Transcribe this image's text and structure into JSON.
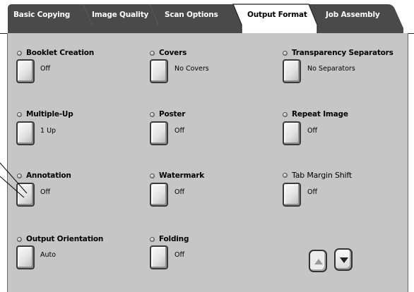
{
  "tabs": [
    {
      "label": "Basic Copying",
      "active": false
    },
    {
      "label": "Image Quality",
      "active": false
    },
    {
      "label": "Scan Options",
      "active": false
    },
    {
      "label": "Output Format",
      "active": true
    },
    {
      "label": "Job Assembly",
      "active": false
    }
  ],
  "features": {
    "booklet_creation": {
      "title": "Booklet Creation",
      "value": "Off"
    },
    "covers": {
      "title": "Covers",
      "value": "No Covers"
    },
    "transparency_separators": {
      "title": "Transparency Separators",
      "value": "No Separators"
    },
    "multiple_up": {
      "title": "Multiple-Up",
      "value": "1 Up"
    },
    "poster": {
      "title": "Poster",
      "value": "Off"
    },
    "repeat_image": {
      "title": "Repeat Image",
      "value": "Off"
    },
    "annotation": {
      "title": "Annotation",
      "value": "Off"
    },
    "watermark": {
      "title": "Watermark",
      "value": "Off"
    },
    "tab_margin_shift": {
      "title": "Tab Margin Shift",
      "value": "Off"
    },
    "output_orientation": {
      "title": "Output Orientation",
      "value": "Auto"
    },
    "folding": {
      "title": "Folding",
      "value": "Off"
    }
  },
  "scroll": {
    "up_icon": "triangle-up-icon",
    "down_icon": "chevron-down-icon"
  },
  "colors": {
    "tab_inactive": "#4a4a4a",
    "tab_active": "#ffffff",
    "panel": "#c6c6c6"
  }
}
